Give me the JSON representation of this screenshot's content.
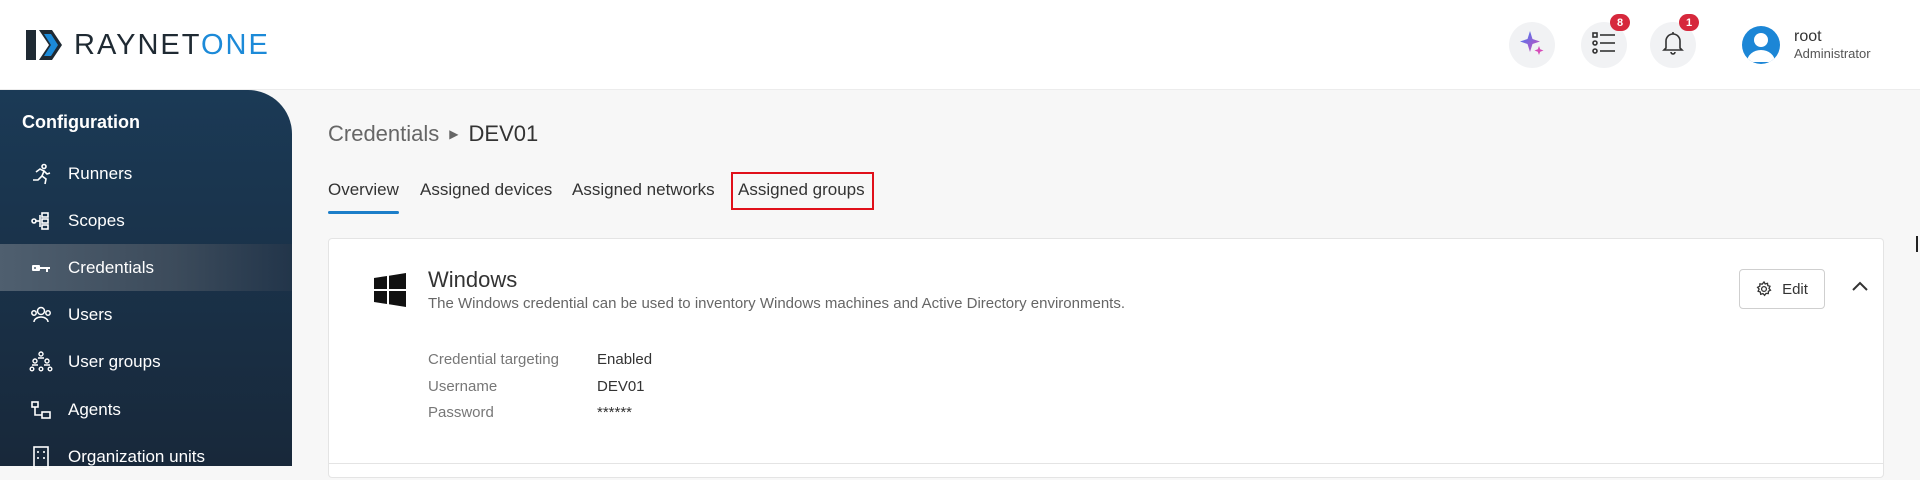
{
  "brand": {
    "name_part1": "RAYNET",
    "name_part2": "ONE",
    "accent_color": "#1c8ad8"
  },
  "header": {
    "icons": [
      {
        "name": "ai-assistant-icon"
      },
      {
        "name": "task-list-icon",
        "badge": "8"
      },
      {
        "name": "notification-bell-icon",
        "badge": "1"
      }
    ],
    "user": {
      "name": "root",
      "role": "Administrator"
    }
  },
  "sidebar": {
    "title": "Configuration",
    "items": [
      {
        "label": "Runners",
        "icon": "runner-icon"
      },
      {
        "label": "Scopes",
        "icon": "scopes-icon"
      },
      {
        "label": "Credentials",
        "icon": "key-icon",
        "active": true
      },
      {
        "label": "Users",
        "icon": "users-icon"
      },
      {
        "label": "User groups",
        "icon": "user-groups-icon"
      },
      {
        "label": "Agents",
        "icon": "agents-icon"
      },
      {
        "label": "Organization units",
        "icon": "building-icon"
      }
    ]
  },
  "breadcrumb": {
    "parent": "Credentials",
    "current": "DEV01"
  },
  "tabs": [
    {
      "label": "Overview",
      "active": true
    },
    {
      "label": "Assigned devices"
    },
    {
      "label": "Assigned networks"
    },
    {
      "label": "Assigned groups",
      "highlighted": true
    }
  ],
  "card": {
    "icon": "windows-icon",
    "title": "Windows",
    "description": "The Windows credential can be used to inventory Windows machines and Active Directory environments.",
    "edit_label": "Edit",
    "fields": [
      {
        "label": "Credential targeting",
        "value": "Enabled"
      },
      {
        "label": "Username",
        "value": "DEV01"
      },
      {
        "label": "Password",
        "value": "******"
      }
    ]
  }
}
